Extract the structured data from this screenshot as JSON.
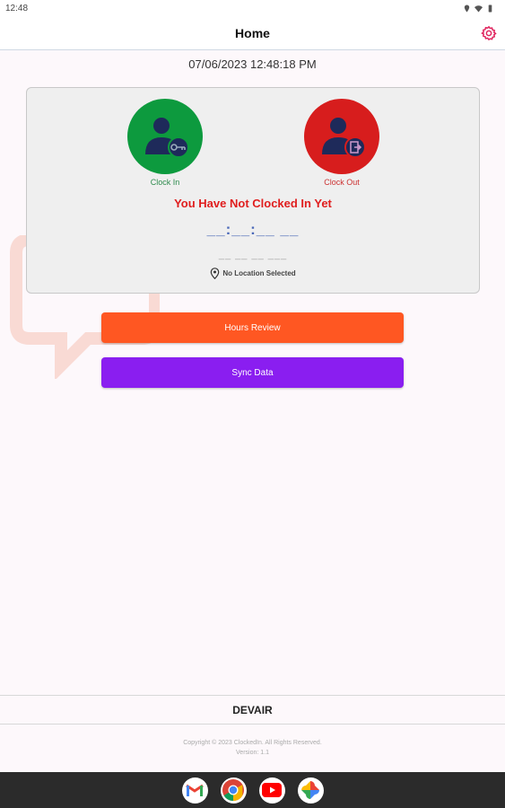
{
  "status_bar": {
    "time": "12:48"
  },
  "app_bar": {
    "title": "Home"
  },
  "datetime": "07/06/2023 12:48:18 PM",
  "clock_card": {
    "clock_in_label": "Clock In",
    "clock_out_label": "Clock Out",
    "status_message": "You Have Not Clocked In Yet",
    "time_placeholder": "__:__:__ __",
    "date_placeholder": "__ __ __ ___",
    "location_text": "No Location Selected"
  },
  "buttons": {
    "hours_review": "Hours Review",
    "sync_data": "Sync Data"
  },
  "footer": {
    "company": "DEVAIR",
    "copyright": "Copyright © 2023 ClockedIn. All Rights Reserved.",
    "version": "Version: 1.1"
  },
  "colors": {
    "clock_in": "#0d9a3e",
    "clock_out": "#d71d1d",
    "hours_review": "#ff5722",
    "sync_data": "#8a1ef0",
    "status_message": "#e01e1e",
    "settings_icon": "#e0245e"
  },
  "dock_apps": [
    "gmail-icon",
    "chrome-icon",
    "youtube-icon",
    "photos-icon"
  ]
}
